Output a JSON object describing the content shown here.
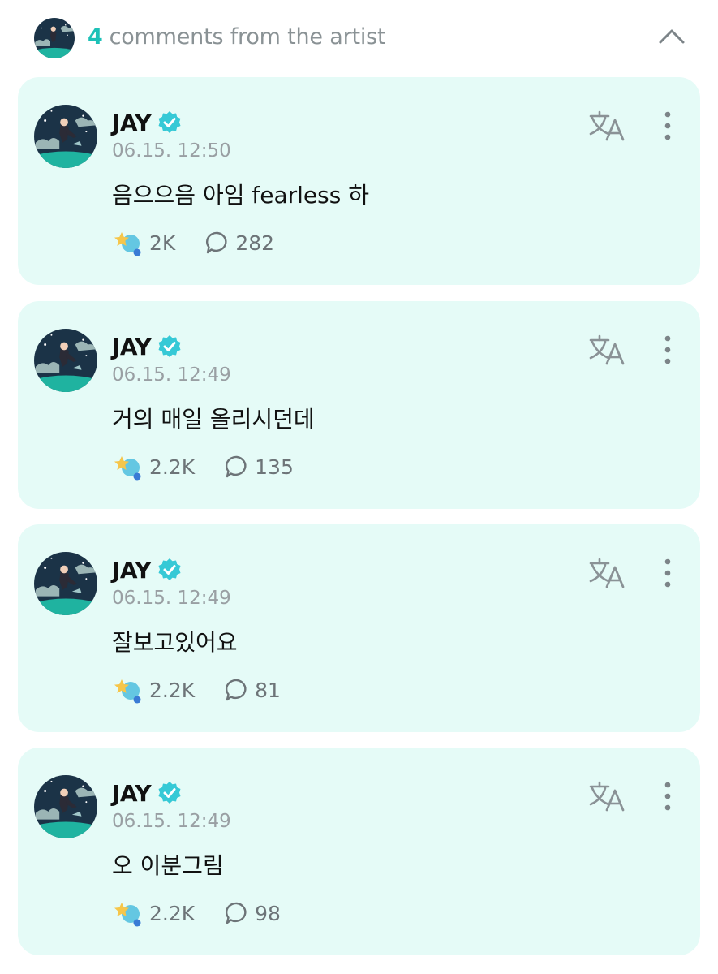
{
  "header": {
    "count": "4",
    "title": "comments from the artist",
    "collapse_icon": "chevron-up-icon"
  },
  "colors": {
    "accent": "#1ec1b7",
    "card_bg": "#e5fbf7",
    "verified": "#36c9d6"
  },
  "comments": [
    {
      "author": "JAY",
      "time": "06.15. 12:50",
      "text": "음으으음 아임 fearless 하",
      "cheers": "2K",
      "replies": "282"
    },
    {
      "author": "JAY",
      "time": "06.15. 12:49",
      "text": "거의 매일 올리시던데",
      "cheers": "2.2K",
      "replies": "135"
    },
    {
      "author": "JAY",
      "time": "06.15. 12:49",
      "text": "잘보고있어요",
      "cheers": "2.2K",
      "replies": "81"
    },
    {
      "author": "JAY",
      "time": "06.15. 12:49",
      "text": "오 이분그림",
      "cheers": "2.2K",
      "replies": "98"
    }
  ]
}
